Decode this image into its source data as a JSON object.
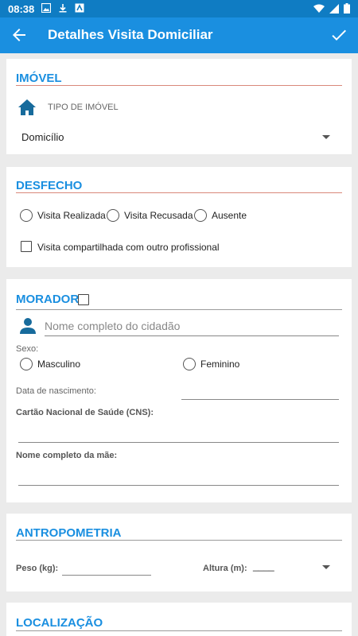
{
  "status_bar": {
    "time": "08:38",
    "icons_left": [
      "image-icon",
      "download-icon",
      "app-notification-icon"
    ],
    "icons_right": [
      "wifi-icon",
      "signal-icon",
      "battery-icon"
    ]
  },
  "app_bar": {
    "title": "Detalhes Visita Domiciliar",
    "back_icon": "arrow-back-icon",
    "confirm_icon": "check-icon",
    "color": "#1a8fe0"
  },
  "imovel": {
    "section_title": "IMÓVEL",
    "field_label": "TIPO DE IMÓVEL",
    "selected_value": "Domicílio",
    "icon": "home-icon"
  },
  "desfecho": {
    "section_title": "DESFECHO",
    "options": [
      "Visita Realizada",
      "Visita Recusada",
      "Ausente"
    ],
    "shared_visit_label": "Visita compartilhada com outro profissional"
  },
  "morador": {
    "section_title": "MORADOR",
    "name_placeholder": "Nome completo do cidadão",
    "sex_label": "Sexo:",
    "sex_options": [
      "Masculino",
      "Feminino"
    ],
    "birth_date_label": "Data de nascimento:",
    "cns_label": "Cartão Nacional de Saúde (CNS):",
    "mother_name_label": "Nome completo da mãe:",
    "icon": "person-icon"
  },
  "antropometria": {
    "section_title": "ANTROPOMETRIA",
    "weight_label": "Peso (kg):",
    "height_label": "Altura (m):",
    "height_value": "____"
  },
  "localizacao": {
    "section_title": "LOCALIZAÇÃO"
  },
  "colors": {
    "accent": "#1a8fe0",
    "section_line_red": "#d9887a",
    "section_line_gray": "#9a9a9a",
    "status_bar": "#0f7cc3"
  }
}
